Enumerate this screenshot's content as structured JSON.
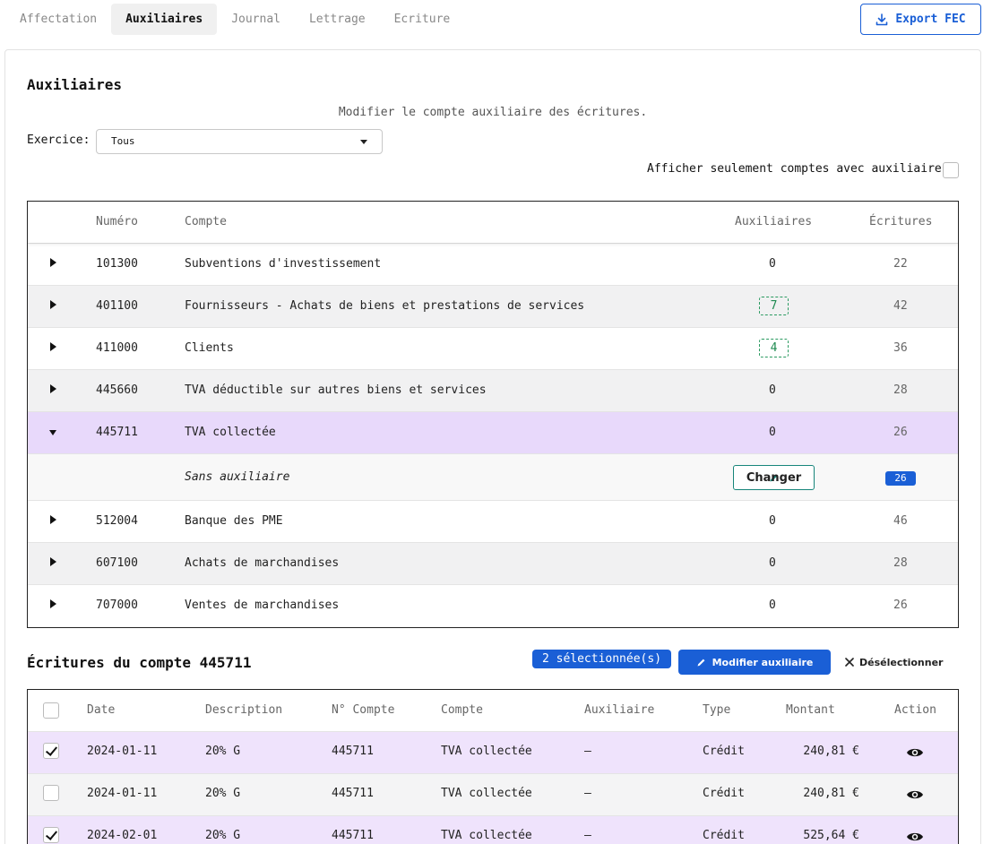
{
  "tabs": [
    {
      "label": "Affectation",
      "active": false
    },
    {
      "label": "Auxiliaires",
      "active": true
    },
    {
      "label": "Journal",
      "active": false
    },
    {
      "label": "Lettrage",
      "active": false
    },
    {
      "label": "Ecriture",
      "active": false
    }
  ],
  "export_label": "Export FEC",
  "section_title": "Auxiliaires",
  "subtitle": "Modifier le compte auxiliaire des écritures.",
  "exercice": {
    "label": "Exercice:",
    "value": "Tous"
  },
  "filter_label": "Afficher seulement comptes avec auxiliaire",
  "accounts_table": {
    "headers": {
      "numero": "Numéro",
      "compte": "Compte",
      "auxiliaires": "Auxiliaires",
      "ecritures": "Écritures"
    },
    "rows": [
      {
        "numero": "101300",
        "compte": "Subventions d'investissement",
        "auxiliaires": "0",
        "ecritures": "22"
      },
      {
        "numero": "401100",
        "compte": "Fournisseurs - Achats de biens et prestations de services",
        "auxiliaires": "7",
        "ecritures": "42"
      },
      {
        "numero": "411000",
        "compte": "Clients",
        "auxiliaires": "4",
        "ecritures": "36"
      },
      {
        "numero": "445660",
        "compte": "TVA déductible sur autres biens et services",
        "auxiliaires": "0",
        "ecritures": "28"
      },
      {
        "numero": "445711",
        "compte": "TVA collectée",
        "auxiliaires": "0",
        "ecritures": "26"
      },
      {
        "numero": "512004",
        "compte": "Banque des PME",
        "auxiliaires": "0",
        "ecritures": "46"
      },
      {
        "numero": "607100",
        "compte": "Achats de marchandises",
        "auxiliaires": "0",
        "ecritures": "28"
      },
      {
        "numero": "707000",
        "compte": "Ventes de marchandises",
        "auxiliaires": "0",
        "ecritures": "26"
      }
    ],
    "expanded": {
      "label": "Sans auxiliaire",
      "button": "Changer",
      "count": "26"
    }
  },
  "entries": {
    "title": "Écritures du compte 445711",
    "selected_label": "2 sélectionnée(s)",
    "modify_label": "Modifier auxiliaire",
    "deselect_label": "Désélectionner",
    "headers": {
      "date": "Date",
      "description": "Description",
      "num": "N° Compte",
      "compte": "Compte",
      "auxiliaire": "Auxiliaire",
      "type": "Type",
      "montant": "Montant",
      "action": "Action"
    },
    "rows": [
      {
        "checked": true,
        "date": "2024-01-11",
        "description": "20% G",
        "num": "445711",
        "compte": "TVA collectée",
        "auxiliaire": "—",
        "type": "Crédit",
        "montant": "240,81 €"
      },
      {
        "checked": false,
        "date": "2024-01-11",
        "description": "20% G",
        "num": "445711",
        "compte": "TVA collectée",
        "auxiliaire": "—",
        "type": "Crédit",
        "montant": "240,81 €"
      },
      {
        "checked": true,
        "date": "2024-02-01",
        "description": "20% G",
        "num": "445711",
        "compte": "TVA collectée",
        "auxiliaire": "—",
        "type": "Crédit",
        "montant": "525,64 €"
      }
    ]
  },
  "colors": {
    "accent": "#1a5fd6",
    "selected_row": "#e8d9fb",
    "badge_green": "#1e8a50",
    "teal": "#17857a"
  }
}
